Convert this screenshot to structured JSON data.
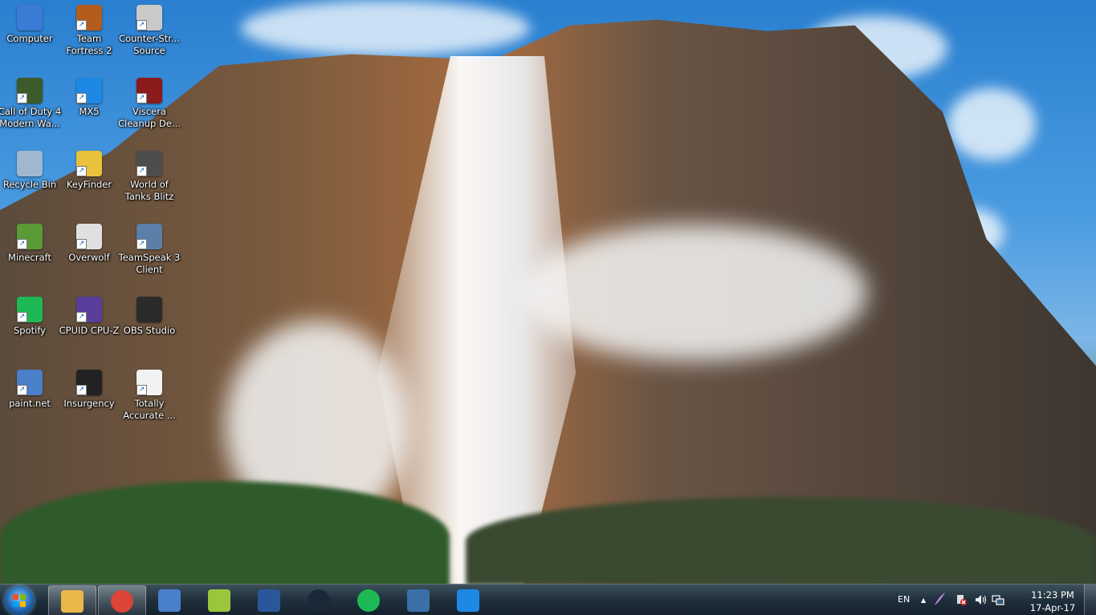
{
  "desktop": {
    "icons": [
      {
        "label": "Computer",
        "icon": "computer-icon",
        "color": "#3a7bd5",
        "shortcut": false
      },
      {
        "label": "Team Fortress 2",
        "icon": "team-fortress-icon",
        "color": "#b35c1e",
        "shortcut": true
      },
      {
        "label": "Counter-Str... Source",
        "icon": "counter-strike-icon",
        "color": "#c9c9c9",
        "shortcut": true
      },
      {
        "label": "Call of Duty 4 Modern Wa...",
        "icon": "call-of-duty-icon",
        "color": "#3d5a2a",
        "shortcut": true
      },
      {
        "label": "MX5",
        "icon": "maxthon-icon",
        "color": "#1e88e5",
        "shortcut": true
      },
      {
        "label": "Viscera Cleanup De...",
        "icon": "viscera-icon",
        "color": "#8b1a1a",
        "shortcut": true
      },
      {
        "label": "Recycle Bin",
        "icon": "recycle-bin-icon",
        "color": "#9fb8cf",
        "shortcut": false
      },
      {
        "label": "KeyFinder",
        "icon": "keyfinder-icon",
        "color": "#e8c23a",
        "shortcut": true
      },
      {
        "label": "World of Tanks Blitz",
        "icon": "world-of-tanks-icon",
        "color": "#4d4d4d",
        "shortcut": true
      },
      {
        "label": "Minecraft",
        "icon": "minecraft-icon",
        "color": "#5b9b35",
        "shortcut": true
      },
      {
        "label": "Overwolf",
        "icon": "overwolf-icon",
        "color": "#e0e0e0",
        "shortcut": true
      },
      {
        "label": "TeamSpeak 3 Client",
        "icon": "teamspeak-icon",
        "color": "#5a7fa8",
        "shortcut": true
      },
      {
        "label": "Spotify",
        "icon": "spotify-icon",
        "color": "#1db954",
        "shortcut": true
      },
      {
        "label": "CPUID CPU-Z",
        "icon": "cpu-z-icon",
        "color": "#5a3e9b",
        "shortcut": true
      },
      {
        "label": "OBS Studio",
        "icon": "obs-icon",
        "color": "#2b2b2b",
        "shortcut": false
      },
      {
        "label": "paint.net",
        "icon": "paint-net-icon",
        "color": "#4a7fc9",
        "shortcut": true
      },
      {
        "label": "Insurgency",
        "icon": "insurgency-icon",
        "color": "#222222",
        "shortcut": true
      },
      {
        "label": "Totally Accurate ...",
        "icon": "document-icon",
        "color": "#f2f2f2",
        "shortcut": true
      }
    ]
  },
  "taskbar": {
    "start": {
      "icon": "windows-logo-icon"
    },
    "buttons": [
      {
        "name": "file-explorer-button",
        "icon": "folder-icon",
        "color": "#e8b84a",
        "open": true
      },
      {
        "name": "chrome-button",
        "icon": "chrome-icon",
        "color": "#db4437",
        "open": true
      },
      {
        "name": "paint-net-button",
        "icon": "paint-net-icon",
        "color": "#4a7fc9",
        "open": false
      },
      {
        "name": "notepad-button",
        "icon": "notepad-icon",
        "color": "#9bc53d",
        "open": false
      },
      {
        "name": "word-button",
        "icon": "word-icon",
        "color": "#2b579a",
        "open": false
      },
      {
        "name": "steam-button",
        "icon": "steam-icon",
        "color": "#1b2838",
        "open": false
      },
      {
        "name": "spotify-button",
        "icon": "spotify-icon",
        "color": "#1db954",
        "open": false
      },
      {
        "name": "monitor-app-button",
        "icon": "monitor-icon",
        "color": "#3b6fa8",
        "open": false
      },
      {
        "name": "maxthon-button",
        "icon": "maxthon-icon",
        "color": "#1e88e5",
        "open": false
      }
    ],
    "tray": {
      "language": "EN",
      "show_hidden": "▲",
      "time": "11:23 PM",
      "date": "17-Apr-17"
    }
  }
}
